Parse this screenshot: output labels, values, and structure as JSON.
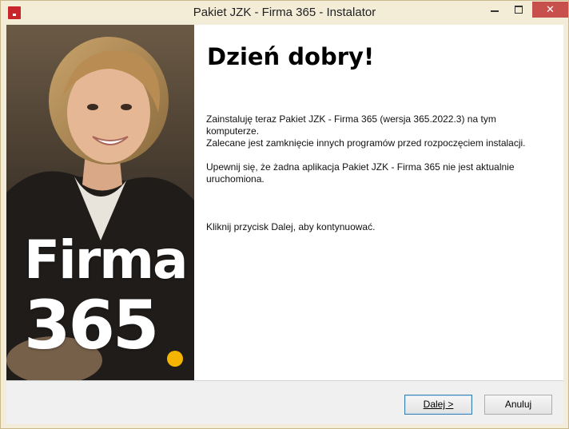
{
  "window": {
    "title": "Pakiet JZK - Firma 365 - Instalator",
    "close_glyph": "✕"
  },
  "sidebar": {
    "brand_word": "Firma",
    "brand_number": "365",
    "dot_color": "#f5b400"
  },
  "main": {
    "heading": "Dzień dobry!",
    "paragraphs": [
      "Zainstaluję teraz Pakiet JZK - Firma 365 (wersja 365.2022.3) na tym komputerze.",
      "Zalecane jest zamknięcie innych programów przed rozpoczęciem instalacji.",
      "Upewnij się, że żadna aplikacja Pakiet JZK - Firma 365 nie jest aktualnie uruchomiona.",
      "Kliknij przycisk Dalej, aby kontynuować."
    ]
  },
  "buttons": {
    "next": "Dalej >",
    "cancel": "Anuluj"
  },
  "colors": {
    "titlebar": "#f3ecd7",
    "close_button": "#c7504d",
    "app_icon": "#c8262c"
  },
  "icons": {
    "app": "installer-app-icon",
    "minimize": "minimize-icon",
    "maximize": "maximize-icon",
    "close": "close-icon"
  }
}
